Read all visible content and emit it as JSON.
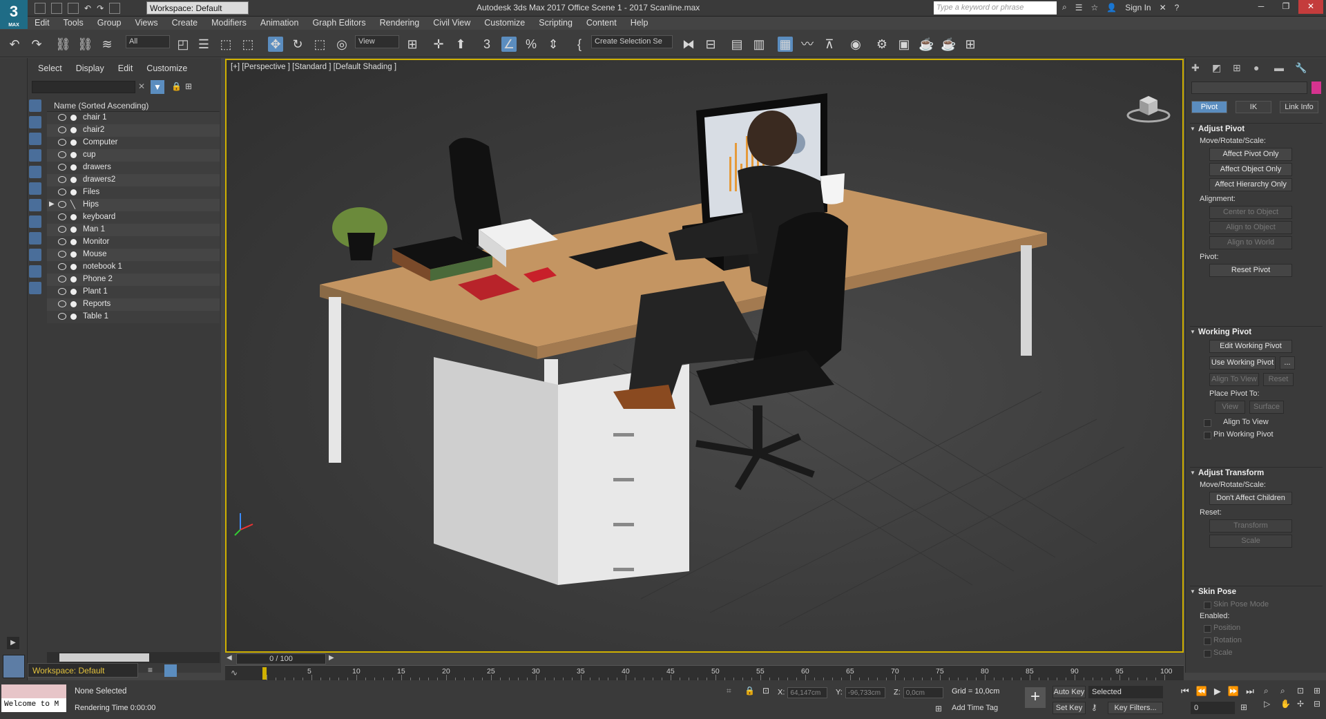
{
  "app": {
    "logo_text": "3",
    "logo_sub": "MAX",
    "workspace": "Workspace: Default",
    "title": "Autodesk 3ds Max 2017    Office Scene 1 - 2017 Scanline.max",
    "search_placeholder": "Type a keyword or phrase",
    "sign_in": "Sign In"
  },
  "menu": [
    "Edit",
    "Tools",
    "Group",
    "Views",
    "Create",
    "Modifiers",
    "Animation",
    "Graph Editors",
    "Rendering",
    "Civil View",
    "Customize",
    "Scripting",
    "Content",
    "Help"
  ],
  "toolbar": {
    "filter": "All",
    "ref_coord": "View",
    "selection_set": "Create Selection Se"
  },
  "scene_explorer": {
    "tabs": [
      "Select",
      "Display",
      "Edit",
      "Customize"
    ],
    "header": "Name (Sorted Ascending)",
    "items": [
      "chair 1",
      "chair2",
      "Computer",
      "cup",
      "drawers",
      "drawers2",
      "Files",
      "Hips",
      "keyboard",
      "Man 1",
      "Monitor",
      "Mouse",
      "notebook 1",
      "Phone 2",
      "Plant 1",
      "Reports",
      "Table 1"
    ],
    "workspace_bottom": "Workspace: Default"
  },
  "viewport": {
    "label": "[+] [Perspective ] [Standard ] [Default Shading ]"
  },
  "command_panel": {
    "tabs": [
      "Pivot",
      "IK",
      "Link Info"
    ],
    "adjust_pivot": {
      "title": "Adjust Pivot",
      "move_label": "Move/Rotate/Scale:",
      "buttons": [
        "Affect Pivot Only",
        "Affect Object Only",
        "Affect Hierarchy Only"
      ],
      "alignment_label": "Alignment:",
      "align_buttons": [
        "Center to Object",
        "Align to Object",
        "Align to World"
      ],
      "pivot_label": "Pivot:",
      "reset": "Reset Pivot"
    },
    "working_pivot": {
      "title": "Working Pivot",
      "edit": "Edit Working Pivot",
      "use": "Use Working Pivot",
      "use_more": "...",
      "align_view": "Align To View",
      "reset": "Reset",
      "place_label": "Place Pivot To:",
      "view": "View",
      "surface": "Surface",
      "align_to_view_check": "Align To View",
      "pin": "Pin Working Pivot"
    },
    "adjust_transform": {
      "title": "Adjust Transform",
      "move_label": "Move/Rotate/Scale:",
      "dont_affect": "Don't Affect Children",
      "reset_label": "Reset:",
      "transform": "Transform",
      "scale": "Scale"
    },
    "skin_pose": {
      "title": "Skin Pose",
      "mode": "Skin Pose Mode",
      "enabled_label": "Enabled:",
      "position": "Position",
      "rotation": "Rotation",
      "scale": "Scale"
    }
  },
  "timeline": {
    "slider": "0 / 100",
    "ticks": [
      "5",
      "10",
      "15",
      "20",
      "25",
      "30",
      "35",
      "40",
      "45",
      "50",
      "55",
      "60",
      "65",
      "70",
      "75",
      "80",
      "85",
      "90",
      "95",
      "100"
    ]
  },
  "status": {
    "maxscript": "Welcome to M",
    "selection": "None Selected",
    "render_time": "Rendering Time  0:00:00",
    "x_label": "X:",
    "x_value": "64,147cm",
    "y_label": "Y:",
    "y_value": "-96,733cm",
    "z_label": "Z:",
    "z_value": "0,0cm",
    "grid": "Grid = 10,0cm",
    "add_time_tag": "Add Time Tag",
    "auto_key": "Auto Key",
    "set_key": "Set Key",
    "key_mode": "Selected",
    "key_filters": "Key Filters...",
    "frame": "0"
  }
}
